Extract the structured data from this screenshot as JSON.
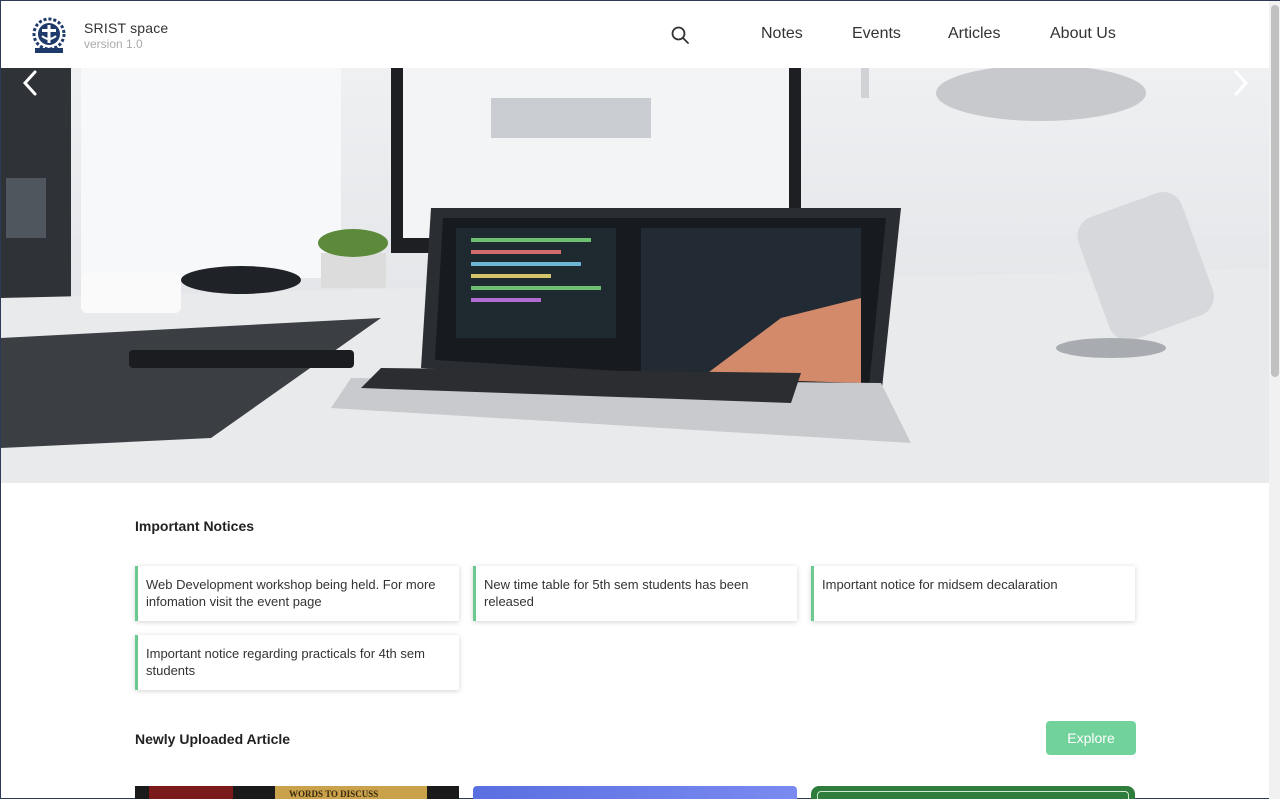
{
  "brand": {
    "title": "SRIST space",
    "version": "version 1.0"
  },
  "nav": {
    "items": [
      "Notes",
      "Events",
      "Articles",
      "About Us"
    ]
  },
  "icons": {
    "search": "search-icon",
    "logo": "college-emblem-icon",
    "prev": "chevron-left-icon",
    "next": "chevron-right-icon"
  },
  "notices": {
    "title": "Important Notices",
    "items": [
      "Web Development workshop being held. For more infomation visit the event page",
      "New time table for 5th sem students has been released",
      "Important notice for midsem decalaration",
      "Important notice regarding practicals for 4th sem students"
    ]
  },
  "articles": {
    "title": "Newly Uploaded Article",
    "explore_label": "Explore",
    "card1_text": "WORDS TO DISCUSS"
  },
  "colors": {
    "accent": "#72d29b",
    "notice_border": "#6cc98f"
  }
}
